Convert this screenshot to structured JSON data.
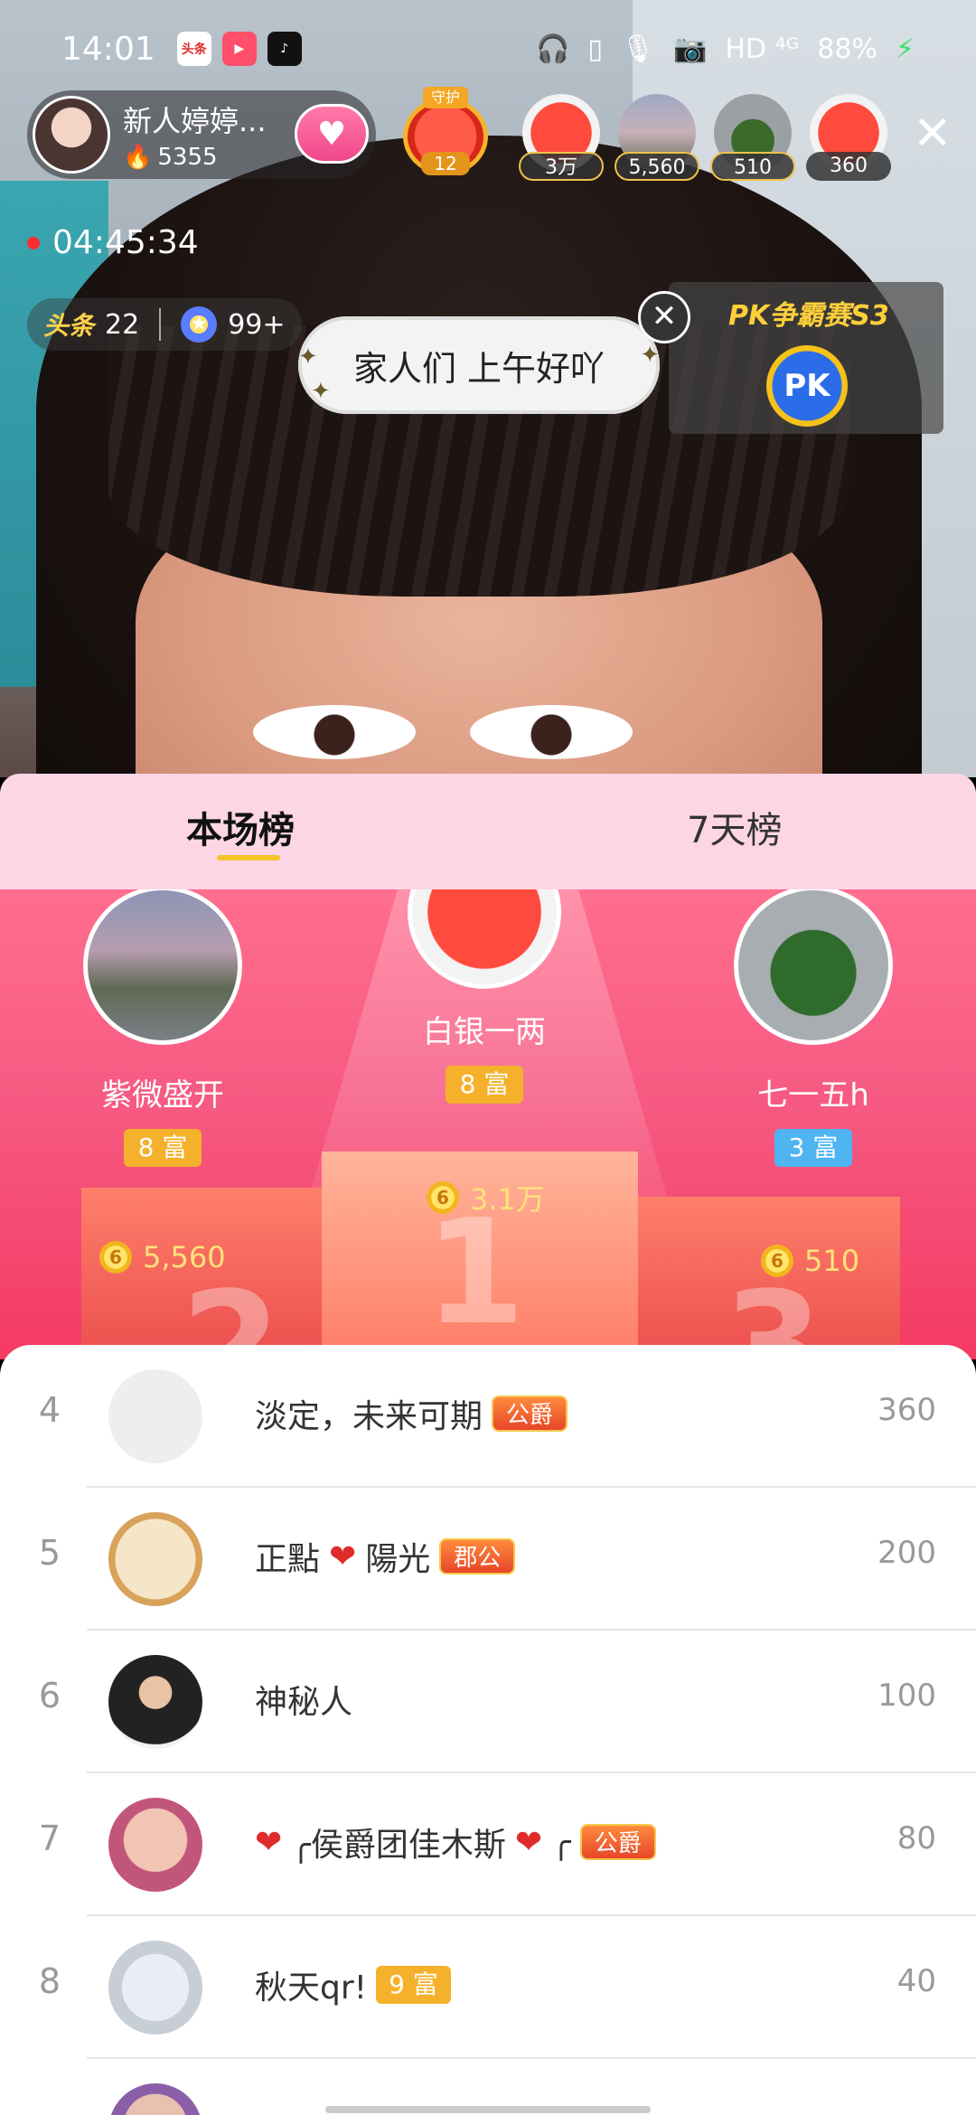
{
  "status_bar": {
    "time": "14:01",
    "apps": [
      "头条",
      "▶",
      "♪"
    ],
    "network": "HD ⁴ᴳ",
    "battery": "88%"
  },
  "header": {
    "anchor_name": "新人婷婷...",
    "heat": "5355",
    "guard_label": "守护",
    "guard_count": "12",
    "viewers": [
      {
        "count": "3万",
        "gold": true
      },
      {
        "count": "5,560",
        "gold": true
      },
      {
        "count": "510",
        "gold": true
      },
      {
        "count": "360",
        "gold": false
      }
    ]
  },
  "live": {
    "duration": "04:45:34",
    "toutiao_count": "22",
    "star_count": "99+",
    "announcement": "家人们 上午好吖",
    "pk_title": "PK争霸赛S3",
    "pk_badge": "PK"
  },
  "tabs": {
    "current": "本场榜",
    "seven_day": "7天榜"
  },
  "podium": {
    "first": {
      "name": "白银一两",
      "level": "8 富",
      "score": "3.1万",
      "place": "1"
    },
    "second": {
      "name": "紫微盛开",
      "level": "8 富",
      "score": "5,560",
      "place": "2"
    },
    "third": {
      "name": "七一五h",
      "level": "3 富",
      "score": "510",
      "place": "3"
    }
  },
  "list": [
    {
      "rank": "4",
      "name": "淡定，未来可期",
      "badge": "公爵",
      "score": "360"
    },
    {
      "rank": "5",
      "name": "正點",
      "name2": "陽光",
      "badge": "郡公",
      "score": "200"
    },
    {
      "rank": "6",
      "name": "神秘人",
      "score": "100"
    },
    {
      "rank": "7",
      "name": "╭侯爵团佳木斯",
      "name2": "╭",
      "badge": "公爵",
      "score": "80"
    },
    {
      "rank": "8",
      "name": "秋天qr!",
      "level": "9 富",
      "score": "40"
    }
  ],
  "colors": {
    "accent_pink": "#f65a82",
    "tab_bg": "#fdd6e6",
    "gold": "#f5b12b"
  }
}
